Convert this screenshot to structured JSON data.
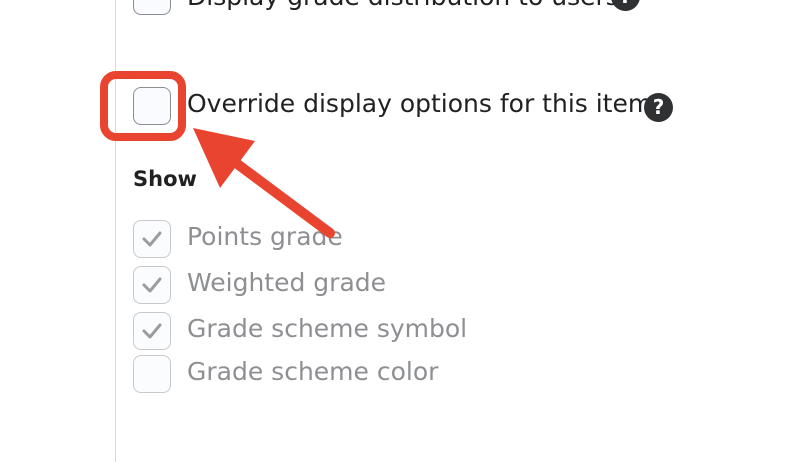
{
  "options": {
    "distribution_label": "Display grade distribution to users",
    "override_label": "Override display options for this item"
  },
  "show": {
    "heading": "Show",
    "items": [
      {
        "label": "Points grade",
        "checked": true
      },
      {
        "label": "Weighted grade",
        "checked": true
      },
      {
        "label": "Grade scheme symbol",
        "checked": true
      },
      {
        "label": "Grade scheme color",
        "checked": false
      }
    ]
  },
  "help_icon_glyph": "?",
  "colors": {
    "annotation": "#e8442f",
    "help_icon": "#2f3133",
    "muted_text": "#8d8f92"
  }
}
